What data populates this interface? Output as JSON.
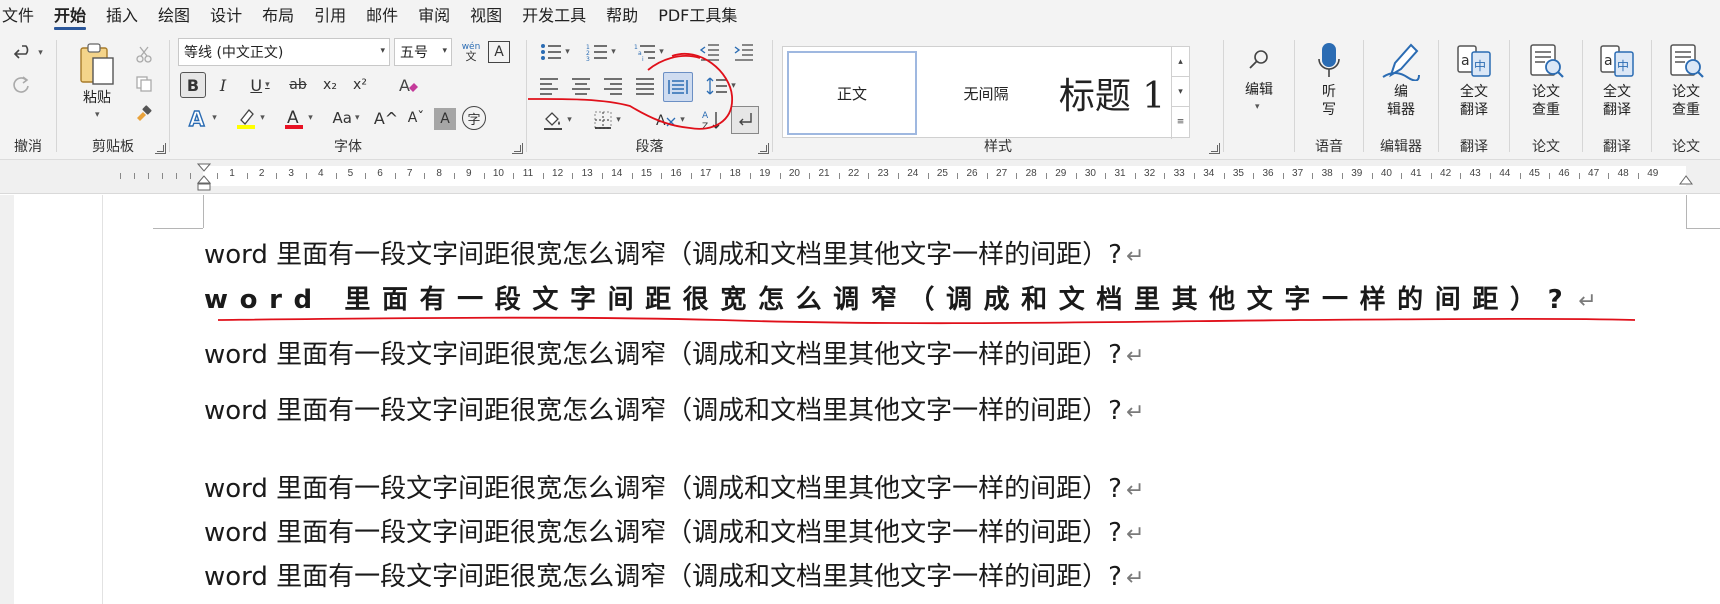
{
  "menu": {
    "tabs": [
      "文件",
      "开始",
      "插入",
      "绘图",
      "设计",
      "布局",
      "引用",
      "邮件",
      "审阅",
      "视图",
      "开发工具",
      "帮助",
      "PDF工具集"
    ],
    "active_index": 1
  },
  "ribbon": {
    "groups": {
      "undo": "撤消",
      "clipboard": "剪贴板",
      "font": "字体",
      "paragraph": "段落",
      "styles": "样式",
      "voice": "语音",
      "editor": "编辑器",
      "translate1": "翻译",
      "paper1": "论文",
      "translate2": "翻译",
      "paper2": "论文"
    },
    "paste_label": "粘贴",
    "font_name": "等线 (中文正文)",
    "font_size": "五号",
    "phonetic_top": "wén",
    "phonetic_bottom": "文",
    "border_char": "A",
    "bold": "B",
    "italic": "I",
    "underline": "U",
    "strike": "ab",
    "subscript": "x₂",
    "superscript": "x²",
    "font_color_letter": "A",
    "case_button": "Aa",
    "grow_font": "A^",
    "shrink_font": "Aˇ",
    "char_shade": "A",
    "enclose_char": "字",
    "styles": {
      "normal": "正文",
      "no_spacing": "无间隔",
      "heading1": "标题 1"
    },
    "edit_label": "编辑",
    "dictate_label": "听\n写",
    "dictate_line1": "听",
    "dictate_line2": "写",
    "editor_line1": "编",
    "editor_line2": "辑器",
    "translate_line1": "全文",
    "translate_line2": "翻译",
    "check_line1": "论文",
    "check_line2": "查重",
    "translate2_line1": "全文",
    "translate2_line2": "翻译",
    "check2_line1": "论文",
    "check2_line2": "查重"
  },
  "ruler": {
    "numbers": [
      "1",
      "2",
      "3",
      "4",
      "5",
      "6",
      "7",
      "8",
      "9",
      "10",
      "11",
      "12",
      "13",
      "14",
      "15",
      "16",
      "17",
      "18",
      "19",
      "20",
      "21",
      "22",
      "23",
      "24",
      "25",
      "26",
      "27",
      "28",
      "29",
      "30",
      "31",
      "32",
      "33",
      "34",
      "35",
      "36",
      "37",
      "38",
      "39",
      "40",
      "41",
      "42",
      "43",
      "44",
      "45",
      "46",
      "47",
      "48",
      "49"
    ]
  },
  "document": {
    "lines": [
      "word 里面有一段文字间距很宽怎么调窄（调成和文档里其他文字一样的间距）?",
      "word 里面有一段文字间距很宽怎么调窄（调成和文档里其他文字一样的间距）?",
      "word 里面有一段文字间距很宽怎么调窄（调成和文档里其他文字一样的间距）?",
      "word 里面有一段文字间距很宽怎么调窄（调成和文档里其他文字一样的间距）?",
      "word 里面有一段文字间距很宽怎么调窄（调成和文档里其他文字一样的间距）?",
      "word 里面有一段文字间距很宽怎么调窄（调成和文档里其他文字一样的间距）?",
      "word 里面有一段文字间距很宽怎么调窄（调成和文档里其他文字一样的间距）?"
    ],
    "return_mark": "↵"
  },
  "colors": {
    "annotation_red": "#e0101a",
    "accent_blue": "#2b579a",
    "highlight_yellow": "#ffff00",
    "font_red": "#e81123"
  }
}
